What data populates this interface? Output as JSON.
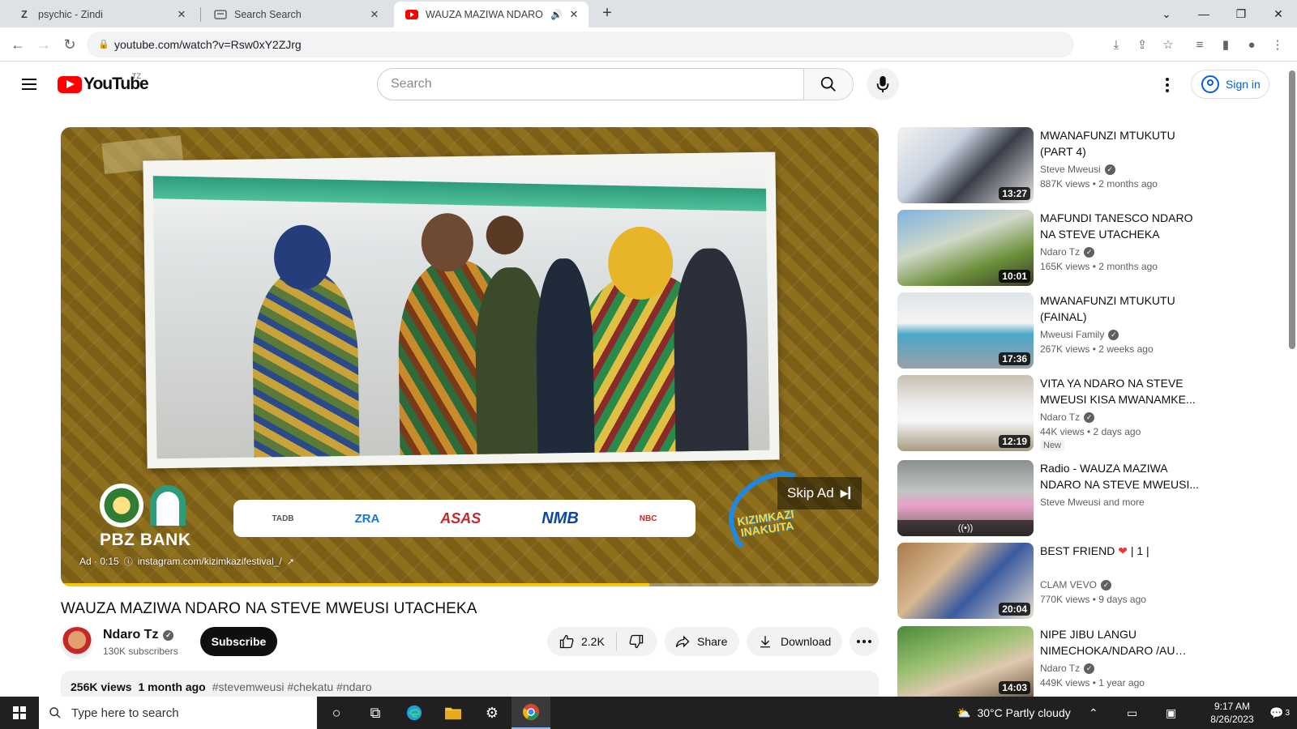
{
  "browser": {
    "tabs": [
      {
        "favicon": "Z",
        "title": "psychic - Zindi"
      },
      {
        "favicon": "search-page-icon",
        "title": "Search Search"
      },
      {
        "favicon": "youtube-icon",
        "title": "WAUZA MAZIWA NDARO NA"
      }
    ],
    "url": "youtube.com/watch?v=Rsw0xY2ZJrg"
  },
  "youtube": {
    "logo_text": "YouTube",
    "country_code": "TZ",
    "search_placeholder": "Search",
    "sign_in_label": "Sign in"
  },
  "ad": {
    "skip_label": "Skip Ad",
    "ad_label": "Ad · 0:15",
    "link": "instagram.com/kizimkazifestival_/",
    "sponsor_bank": "PBZ BANK",
    "sponsor_logos": [
      "TADB",
      "ZRA",
      "ASAS",
      "NMB",
      "NBC"
    ],
    "festival_text": [
      "KIZIMKAZI",
      "INAKUITA"
    ],
    "progress_fraction": 0.72
  },
  "video": {
    "title": "WAUZA MAZIWA NDARO NA STEVE MWEUSI UTACHEKA",
    "channel": "Ndaro Tz",
    "subscribers": "130K subscribers",
    "subscribe_label": "Subscribe",
    "likes": "2.2K",
    "share_label": "Share",
    "download_label": "Download",
    "views": "256K views",
    "age": "1 month ago",
    "tags": "#stevemweusi #chekatu #ndaro"
  },
  "recommendations": [
    {
      "title": "MWANAFUNZI MTUKUTU (PART 4)",
      "channel": "Steve Mweusi",
      "verified": true,
      "meta": "887K views  • 2 months ago",
      "duration": "13:27"
    },
    {
      "title": "MAFUNDI TANESCO NDARO NA STEVE UTACHEKA",
      "channel": "Ndaro Tz",
      "verified": true,
      "meta": "165K views  • 2 months ago",
      "duration": "10:01"
    },
    {
      "title": "MWANAFUNZI MTUKUTU (FAINAL)",
      "channel": "Mweusi Family",
      "verified": true,
      "meta": "267K views  • 2 weeks ago",
      "duration": "17:36"
    },
    {
      "title": "VITA YA NDARO NA STEVE MWEUSI KISA MWANAMKE...",
      "channel": "Ndaro Tz",
      "verified": true,
      "meta": "44K views  • 2 days ago",
      "duration": "12:19",
      "badge": "New"
    },
    {
      "title": "Radio - WAUZA MAZIWA NDARO NA STEVE MWEUSI...",
      "channel": "Steve Mweusi and more",
      "verified": false,
      "meta": "",
      "duration": "((•))"
    },
    {
      "title": "BEST FRIEND",
      "title_suffix": "| 1 |",
      "channel": "CLAM VEVO",
      "verified": true,
      "meta": "770K views  • 9 days ago",
      "duration": "20:04"
    },
    {
      "title": "NIPE JIBU LANGU NIMECHOKA/NDARO /AU BAS...",
      "channel": "Ndaro Tz",
      "verified": true,
      "meta": "449K views  • 1 year ago",
      "duration": "14:03"
    }
  ],
  "taskbar": {
    "search_placeholder": "Type here to search",
    "weather": "30°C  Partly cloudy",
    "time": "9:17 AM",
    "date": "8/26/2023",
    "notification_count": "3"
  }
}
